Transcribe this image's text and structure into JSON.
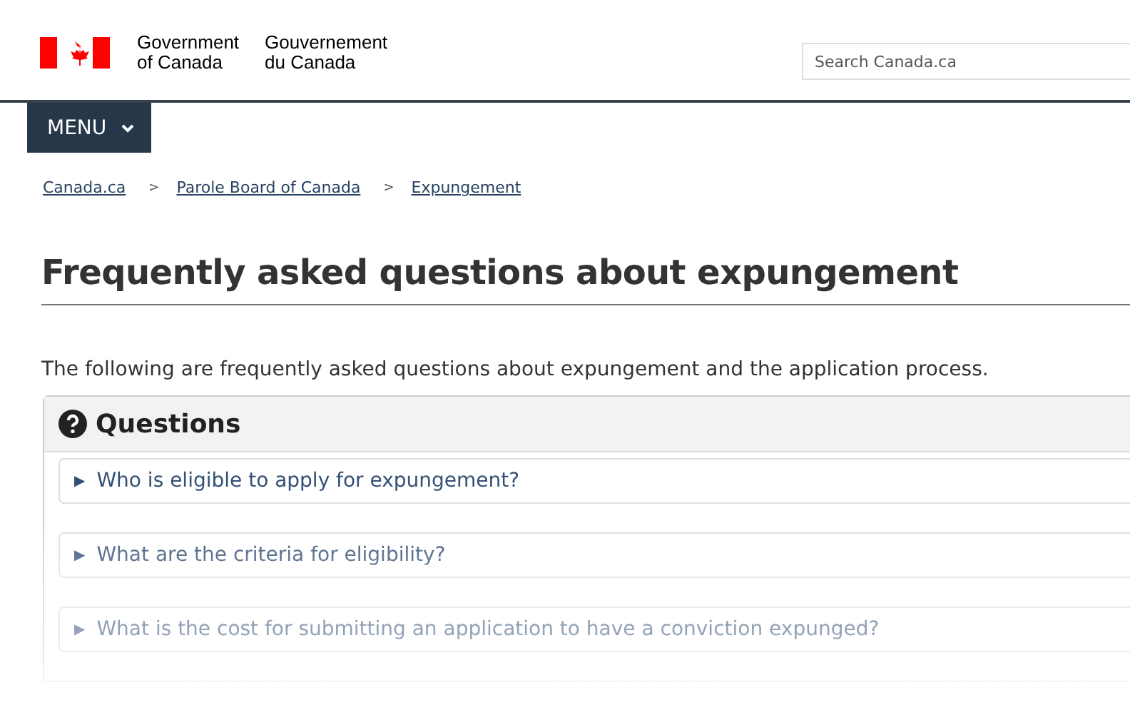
{
  "header": {
    "signature_en": [
      "Government",
      "of Canada"
    ],
    "signature_fr": [
      "Gouvernement",
      "du Canada"
    ],
    "search": {
      "placeholder": "Search Canada.ca"
    }
  },
  "menu_button": {
    "label": "MENU"
  },
  "breadcrumbs": [
    {
      "label": "Canada.ca",
      "separator": ">"
    },
    {
      "label": "Parole Board of Canada",
      "separator": ">"
    },
    {
      "label": "Expungement"
    }
  ],
  "title": "Frequently asked questions about expungement",
  "intro": "The following are frequently asked questions about expungement and the application process.",
  "panel": {
    "title": "Questions",
    "questions": [
      {
        "marker": "▶",
        "text": "Who is eligible to apply for expungement?"
      },
      {
        "marker": "▶",
        "text": "What are the criteria for eligibility?"
      },
      {
        "marker": "▶",
        "text": "What is the cost for submitting an application to have a conviction expunged?"
      }
    ]
  }
}
